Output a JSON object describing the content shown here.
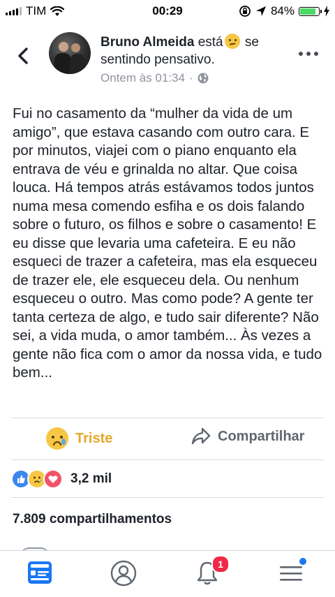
{
  "status_bar": {
    "carrier": "TIM",
    "time": "00:29",
    "battery_percent": "84%",
    "battery_level": 0.84,
    "icons": [
      "signal-icon",
      "wifi-icon",
      "rotation-lock-icon",
      "location-arrow-icon",
      "battery-icon",
      "charging-bolt-icon"
    ]
  },
  "post": {
    "author": "Bruno Almeida",
    "feeling_prefix": "está",
    "feeling_suffix": "se sentindo pensativo.",
    "timestamp": "Ontem às 01:34",
    "separator": "·",
    "audience_icon": "globe-icon",
    "text": "Fui no casamento da “mulher da vida de um amigo”, que estava casando com outro cara. E por minutos, viajei com o piano enquanto ela entrava de véu e grinalda no altar. Que coisa louca. Há tempos atrás estávamos todos juntos numa mesa comendo esfiha e os dois falando sobre o futuro, os filhos e sobre o casamento! E eu disse que levaria uma cafeteira. E eu não esqueci de trazer a cafeteira, mas ela esqueceu de trazer ele, ele esqueceu dela. Ou nenhum esqueceu o outro. Mas como pode? A gente ter tanta certeza de algo, e tudo sair diferente? Não sei, a vida muda, o amor também... Às vezes a gente não fica com o amor da nossa vida, e tudo bem..."
  },
  "actions": {
    "reaction_label": "Triste",
    "share_label": "Compartilhar"
  },
  "reactions": {
    "count": "3,2 mil",
    "types": [
      "like-icon",
      "sad-icon",
      "love-icon"
    ]
  },
  "shares": {
    "count_text": "7.809 compartilhamentos"
  },
  "bottom_nav": {
    "items": [
      "news-feed-icon",
      "profile-icon",
      "notifications-icon",
      "menu-icon"
    ],
    "notification_badge": "1"
  },
  "colors": {
    "accent_blue": "#1877f2",
    "sad_reaction_yellow": "#e5a82a",
    "badge_red": "#f02849",
    "battery_green": "#4cd964"
  }
}
